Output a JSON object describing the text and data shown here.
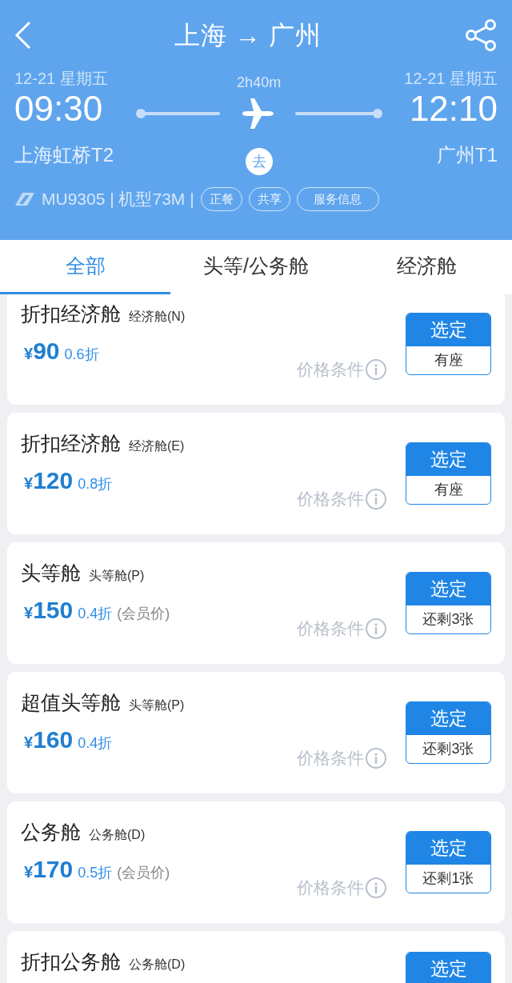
{
  "header": {
    "title": "上海 → 广州",
    "depart": {
      "date": "12-21 星期五",
      "time": "09:30",
      "airport": "上海虹桥T2"
    },
    "arrive": {
      "date": "12-21 星期五",
      "time": "12:10",
      "airport": "广州T1"
    },
    "duration": "2h40m",
    "direction": "去",
    "flight_info": "MU9305 | 机型73M |",
    "tags": [
      "正餐",
      "共享",
      "服务信息"
    ]
  },
  "tabs": [
    {
      "label": "全部",
      "selected": true
    },
    {
      "label": "头等/公务舱",
      "selected": false
    },
    {
      "label": "经济舱",
      "selected": false
    }
  ],
  "fares": [
    {
      "name": "折扣经济舱",
      "cabin": "经济舱(N)",
      "currency": "¥",
      "price": "90",
      "discount": "0.6折",
      "conditions": "价格条件",
      "button": "选定",
      "availability": "有座"
    },
    {
      "name": "折扣经济舱",
      "cabin": "经济舱(E)",
      "currency": "¥",
      "price": "120",
      "discount": "0.8折",
      "conditions": "价格条件",
      "button": "选定",
      "availability": "有座"
    },
    {
      "name": "头等舱",
      "cabin": "头等舱(P)",
      "currency": "¥",
      "price": "150",
      "discount": "0.4折",
      "note": "(会员价)",
      "conditions": "价格条件",
      "button": "选定",
      "availability": "还剩3张"
    },
    {
      "name": "超值头等舱",
      "cabin": "头等舱(P)",
      "currency": "¥",
      "price": "160",
      "discount": "0.4折",
      "conditions": "价格条件",
      "button": "选定",
      "availability": "还剩3张"
    },
    {
      "name": "公务舱",
      "cabin": "公务舱(D)",
      "currency": "¥",
      "price": "170",
      "discount": "0.5折",
      "note": "(会员价)",
      "conditions": "价格条件",
      "button": "选定",
      "availability": "还剩1张"
    },
    {
      "name": "折扣公务舱",
      "cabin": "公务舱(D)",
      "button": "选定"
    }
  ]
}
